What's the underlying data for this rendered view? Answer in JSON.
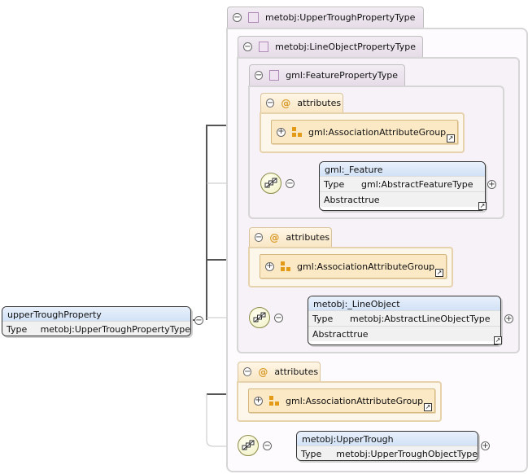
{
  "root_element": {
    "name": "upperTroughProperty",
    "type_key": "Type",
    "type_value": "metobj:UpperTroughPropertyType"
  },
  "upper_type": {
    "label": "metobj:UpperTroughPropertyType"
  },
  "line_object_type": {
    "label": "metobj:LineObjectPropertyType"
  },
  "feature_type": {
    "label": "gml:FeaturePropertyType"
  },
  "attributes_label": "attributes",
  "attribute_group_label": "gml:AssociationAttributeGroup",
  "feature_element": {
    "name": "gml:_Feature",
    "type_key": "Type",
    "type_value": "gml:AbstractFeatureType",
    "abstract_key": "Abstract",
    "abstract_value": "true"
  },
  "line_object_element": {
    "name": "metobj:_LineObject",
    "type_key": "Type",
    "type_value": "metobj:AbstractLineObjectType",
    "abstract_key": "Abstract",
    "abstract_value": "true"
  },
  "upper_trough_element": {
    "name": "metobj:UpperTrough",
    "type_key": "Type",
    "type_value": "metobj:UpperTroughObjectType"
  }
}
